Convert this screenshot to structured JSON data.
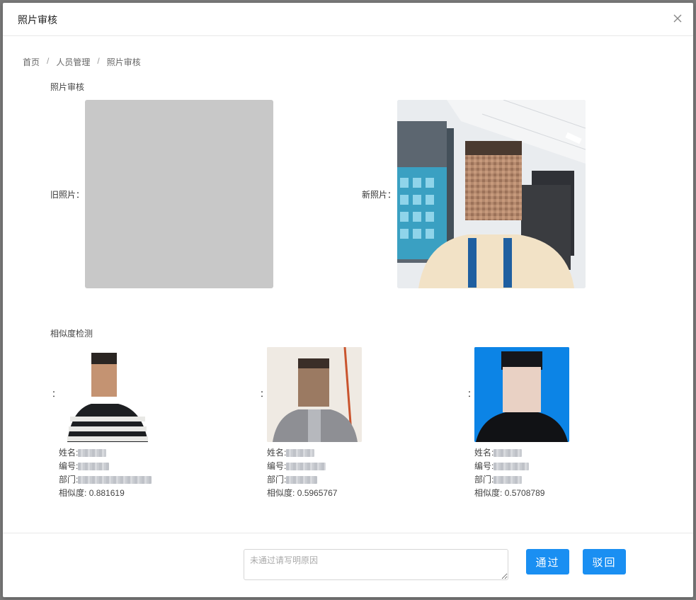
{
  "dialog": {
    "title": "照片审核"
  },
  "breadcrumb": [
    "首页",
    "人员管理",
    "照片审核"
  ],
  "review": {
    "section_title": "照片审核",
    "old_label": "旧照片：",
    "new_label": "新照片："
  },
  "similarity": {
    "section_title": "相似度检测",
    "colon": "：",
    "fields": {
      "name": "姓名:",
      "id": "编号:",
      "dept": "部门:",
      "score": "相似度:"
    },
    "candidates": [
      {
        "score": "0.881619"
      },
      {
        "score": "0.5965767"
      },
      {
        "score": "0.5708789"
      }
    ]
  },
  "footer": {
    "reason_placeholder": "未通过请写明原因",
    "approve_label": "通过",
    "reject_label": "驳回"
  },
  "colors": {
    "primary": "#1a8ff2",
    "id_photo_bg": "#0c84e6"
  },
  "icons": {
    "close": "close-icon"
  }
}
